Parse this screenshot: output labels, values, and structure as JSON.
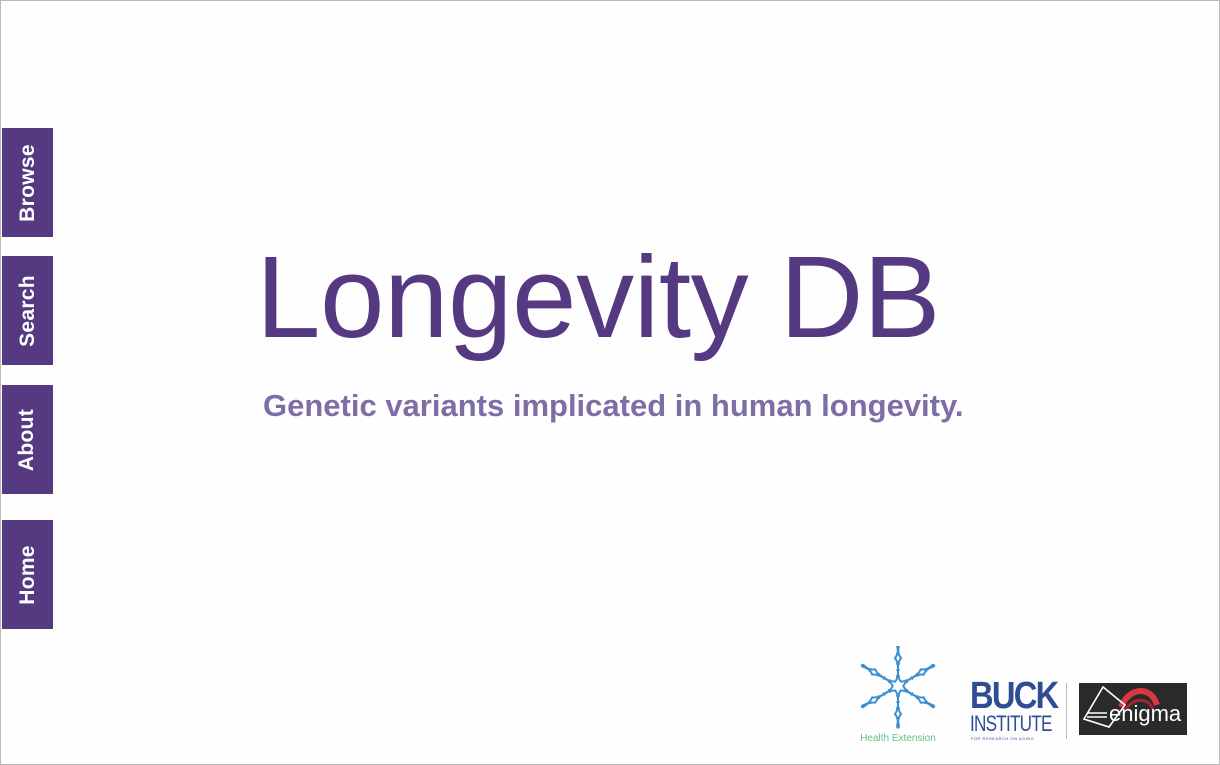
{
  "nav": {
    "items": [
      {
        "id": "browse",
        "label": "Browse"
      },
      {
        "id": "search",
        "label": "Search"
      },
      {
        "id": "about",
        "label": "About"
      },
      {
        "id": "home",
        "label": "Home"
      }
    ]
  },
  "hero": {
    "title": "Longevity DB",
    "tagline": "Genetic variants implicated in human longevity."
  },
  "sponsors": {
    "health_extension": {
      "label": "Health Extension",
      "icon": "dna-helix-icon"
    },
    "buck_institute": {
      "name_line1": "BUCK",
      "name_line2": "INSTITUTE",
      "tagline": "FOR RESEARCH ON AGING"
    },
    "enigma": {
      "name": "enigma",
      "icon": "enigma-logo"
    }
  },
  "colors": {
    "brand_purple": "#553a82",
    "tagline_purple": "#7d6fa5",
    "health_extension_green": "#64c08a",
    "buck_blue": "#2f4d93",
    "enigma_red": "#d9383f"
  }
}
